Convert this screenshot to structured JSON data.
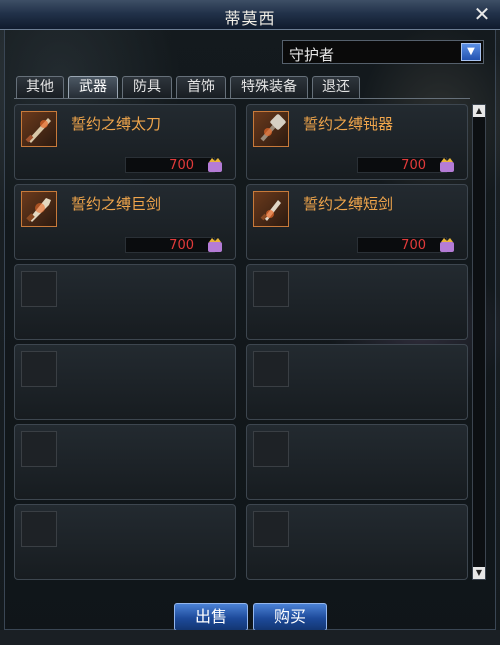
{
  "window": {
    "title": "蒂莫西",
    "close_icon": "close-icon"
  },
  "filter": {
    "selected": "守护者"
  },
  "tabs": [
    {
      "label": "其他",
      "active": false
    },
    {
      "label": "武器",
      "active": true
    },
    {
      "label": "防具",
      "active": false
    },
    {
      "label": "首饰",
      "active": false
    },
    {
      "label": "特殊装备",
      "active": false
    },
    {
      "label": "退还",
      "active": false
    }
  ],
  "items": [
    {
      "name": "誓约之缚太刀",
      "price": "700",
      "icon": "katana-icon"
    },
    {
      "name": "誓约之缚钝器",
      "price": "700",
      "icon": "blunt-weapon-icon"
    },
    {
      "name": "誓约之缚巨剑",
      "price": "700",
      "icon": "greatsword-icon"
    },
    {
      "name": "誓约之缚短剑",
      "price": "700",
      "icon": "shortsword-icon"
    }
  ],
  "buttons": {
    "sell": "出售",
    "buy": "购买"
  },
  "colors": {
    "item_name": "#f0a54b",
    "price": "#e23a3a",
    "button": "#1d4a9a"
  }
}
